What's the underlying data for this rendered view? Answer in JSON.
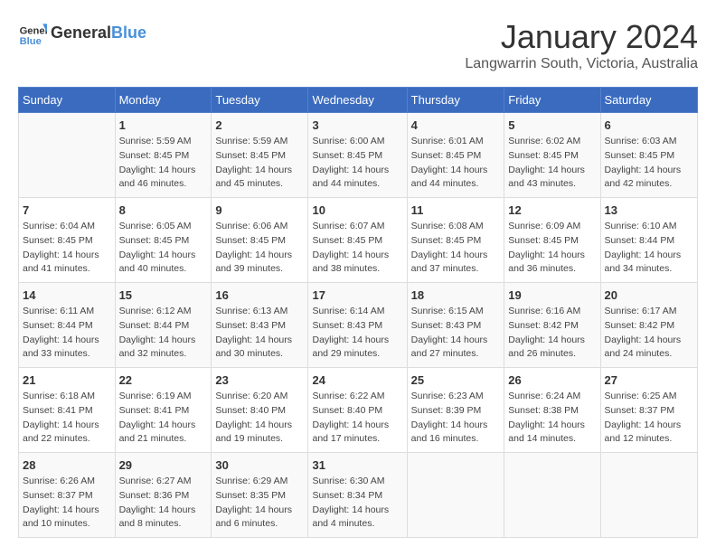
{
  "header": {
    "logo_general": "General",
    "logo_blue": "Blue",
    "title": "January 2024",
    "subtitle": "Langwarrin South, Victoria, Australia"
  },
  "calendar": {
    "days_of_week": [
      "Sunday",
      "Monday",
      "Tuesday",
      "Wednesday",
      "Thursday",
      "Friday",
      "Saturday"
    ],
    "weeks": [
      [
        {
          "day": "",
          "info": ""
        },
        {
          "day": "1",
          "info": "Sunrise: 5:59 AM\nSunset: 8:45 PM\nDaylight: 14 hours\nand 46 minutes."
        },
        {
          "day": "2",
          "info": "Sunrise: 5:59 AM\nSunset: 8:45 PM\nDaylight: 14 hours\nand 45 minutes."
        },
        {
          "day": "3",
          "info": "Sunrise: 6:00 AM\nSunset: 8:45 PM\nDaylight: 14 hours\nand 44 minutes."
        },
        {
          "day": "4",
          "info": "Sunrise: 6:01 AM\nSunset: 8:45 PM\nDaylight: 14 hours\nand 44 minutes."
        },
        {
          "day": "5",
          "info": "Sunrise: 6:02 AM\nSunset: 8:45 PM\nDaylight: 14 hours\nand 43 minutes."
        },
        {
          "day": "6",
          "info": "Sunrise: 6:03 AM\nSunset: 8:45 PM\nDaylight: 14 hours\nand 42 minutes."
        }
      ],
      [
        {
          "day": "7",
          "info": "Sunrise: 6:04 AM\nSunset: 8:45 PM\nDaylight: 14 hours\nand 41 minutes."
        },
        {
          "day": "8",
          "info": "Sunrise: 6:05 AM\nSunset: 8:45 PM\nDaylight: 14 hours\nand 40 minutes."
        },
        {
          "day": "9",
          "info": "Sunrise: 6:06 AM\nSunset: 8:45 PM\nDaylight: 14 hours\nand 39 minutes."
        },
        {
          "day": "10",
          "info": "Sunrise: 6:07 AM\nSunset: 8:45 PM\nDaylight: 14 hours\nand 38 minutes."
        },
        {
          "day": "11",
          "info": "Sunrise: 6:08 AM\nSunset: 8:45 PM\nDaylight: 14 hours\nand 37 minutes."
        },
        {
          "day": "12",
          "info": "Sunrise: 6:09 AM\nSunset: 8:45 PM\nDaylight: 14 hours\nand 36 minutes."
        },
        {
          "day": "13",
          "info": "Sunrise: 6:10 AM\nSunset: 8:44 PM\nDaylight: 14 hours\nand 34 minutes."
        }
      ],
      [
        {
          "day": "14",
          "info": "Sunrise: 6:11 AM\nSunset: 8:44 PM\nDaylight: 14 hours\nand 33 minutes."
        },
        {
          "day": "15",
          "info": "Sunrise: 6:12 AM\nSunset: 8:44 PM\nDaylight: 14 hours\nand 32 minutes."
        },
        {
          "day": "16",
          "info": "Sunrise: 6:13 AM\nSunset: 8:43 PM\nDaylight: 14 hours\nand 30 minutes."
        },
        {
          "day": "17",
          "info": "Sunrise: 6:14 AM\nSunset: 8:43 PM\nDaylight: 14 hours\nand 29 minutes."
        },
        {
          "day": "18",
          "info": "Sunrise: 6:15 AM\nSunset: 8:43 PM\nDaylight: 14 hours\nand 27 minutes."
        },
        {
          "day": "19",
          "info": "Sunrise: 6:16 AM\nSunset: 8:42 PM\nDaylight: 14 hours\nand 26 minutes."
        },
        {
          "day": "20",
          "info": "Sunrise: 6:17 AM\nSunset: 8:42 PM\nDaylight: 14 hours\nand 24 minutes."
        }
      ],
      [
        {
          "day": "21",
          "info": "Sunrise: 6:18 AM\nSunset: 8:41 PM\nDaylight: 14 hours\nand 22 minutes."
        },
        {
          "day": "22",
          "info": "Sunrise: 6:19 AM\nSunset: 8:41 PM\nDaylight: 14 hours\nand 21 minutes."
        },
        {
          "day": "23",
          "info": "Sunrise: 6:20 AM\nSunset: 8:40 PM\nDaylight: 14 hours\nand 19 minutes."
        },
        {
          "day": "24",
          "info": "Sunrise: 6:22 AM\nSunset: 8:40 PM\nDaylight: 14 hours\nand 17 minutes."
        },
        {
          "day": "25",
          "info": "Sunrise: 6:23 AM\nSunset: 8:39 PM\nDaylight: 14 hours\nand 16 minutes."
        },
        {
          "day": "26",
          "info": "Sunrise: 6:24 AM\nSunset: 8:38 PM\nDaylight: 14 hours\nand 14 minutes."
        },
        {
          "day": "27",
          "info": "Sunrise: 6:25 AM\nSunset: 8:37 PM\nDaylight: 14 hours\nand 12 minutes."
        }
      ],
      [
        {
          "day": "28",
          "info": "Sunrise: 6:26 AM\nSunset: 8:37 PM\nDaylight: 14 hours\nand 10 minutes."
        },
        {
          "day": "29",
          "info": "Sunrise: 6:27 AM\nSunset: 8:36 PM\nDaylight: 14 hours\nand 8 minutes."
        },
        {
          "day": "30",
          "info": "Sunrise: 6:29 AM\nSunset: 8:35 PM\nDaylight: 14 hours\nand 6 minutes."
        },
        {
          "day": "31",
          "info": "Sunrise: 6:30 AM\nSunset: 8:34 PM\nDaylight: 14 hours\nand 4 minutes."
        },
        {
          "day": "",
          "info": ""
        },
        {
          "day": "",
          "info": ""
        },
        {
          "day": "",
          "info": ""
        }
      ]
    ]
  }
}
